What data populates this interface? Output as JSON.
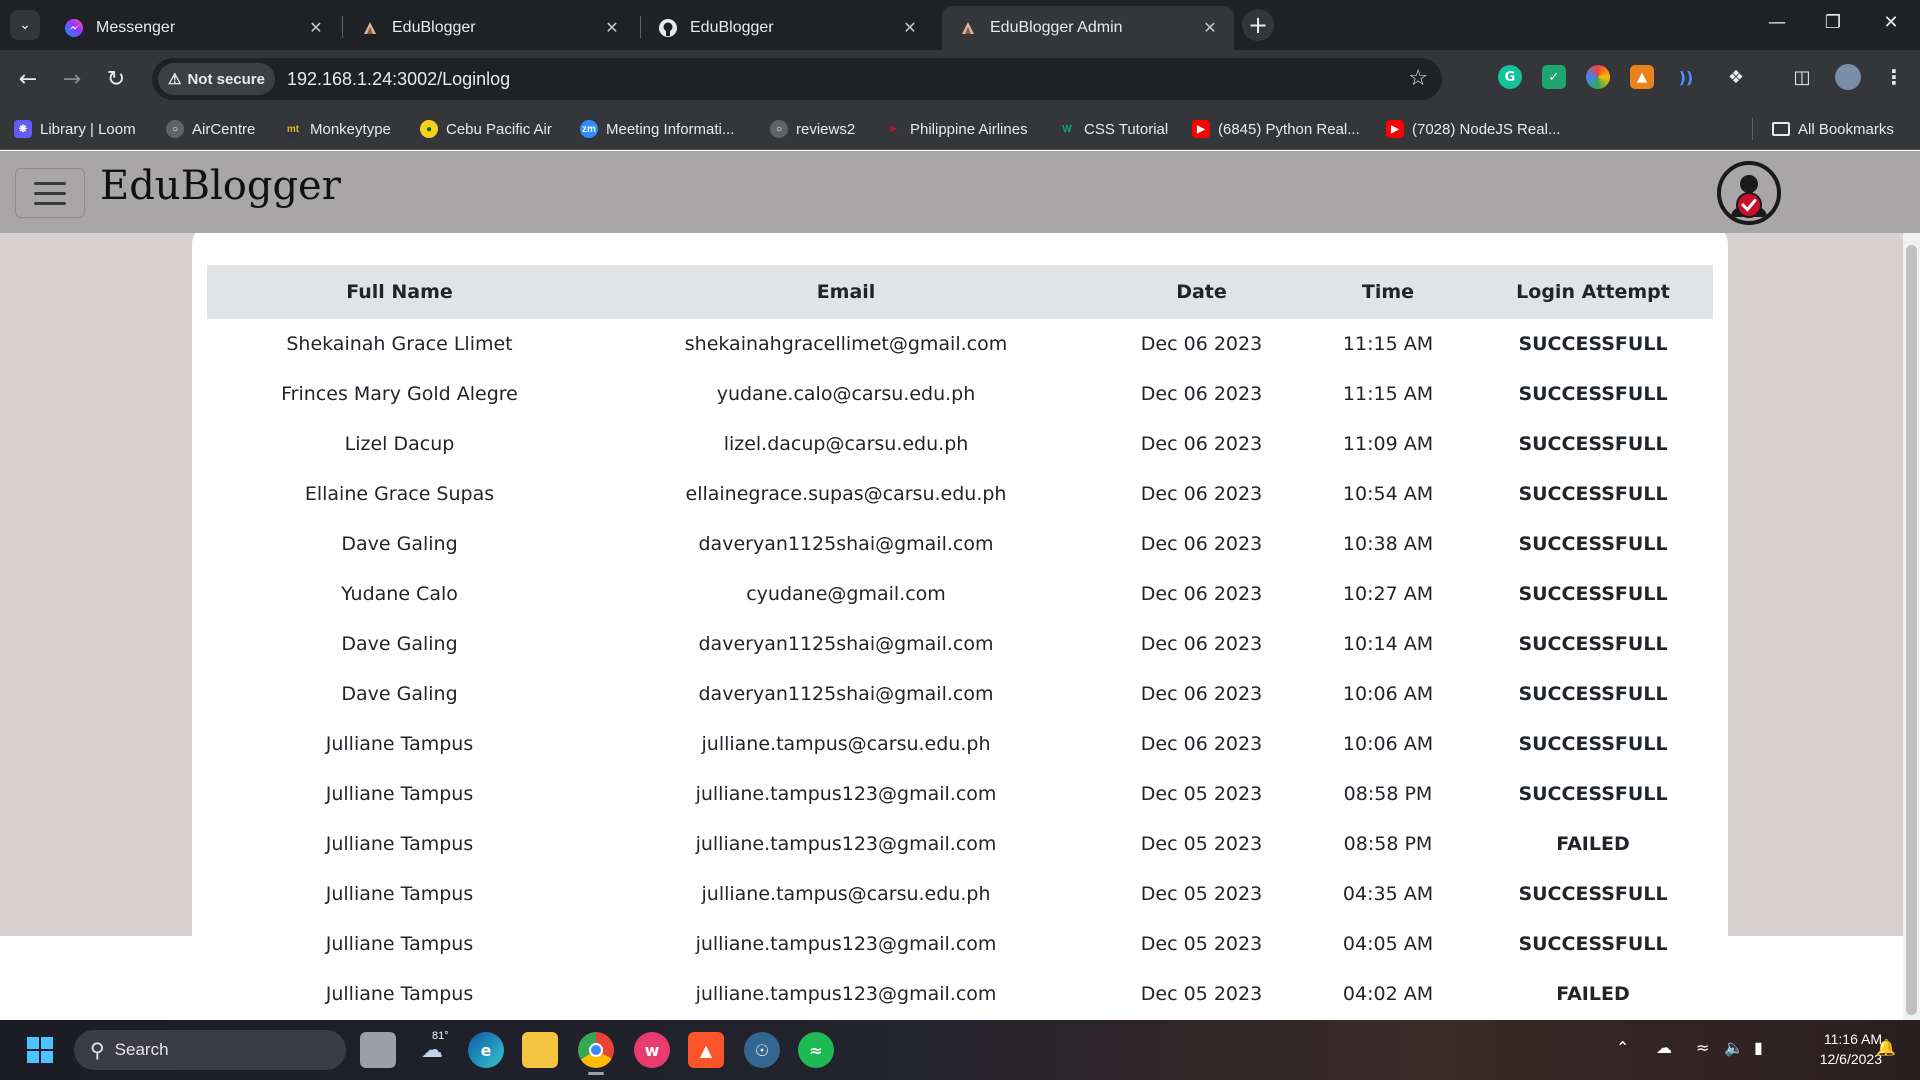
{
  "browser": {
    "tabs": [
      {
        "title": "Messenger",
        "icon": "messenger-icon",
        "active": false
      },
      {
        "title": "EduBlogger",
        "icon": "edublogger-icon",
        "active": false
      },
      {
        "title": "EduBlogger",
        "icon": "github-icon",
        "active": false
      },
      {
        "title": "EduBlogger Admin",
        "icon": "edublogger-icon",
        "active": true
      }
    ],
    "security_label": "Not secure",
    "url": "192.168.1.24:3002/Loginlog",
    "bookmarks": [
      {
        "label": "Library | Loom",
        "color": "#625df5"
      },
      {
        "label": "AirCentre",
        "color": "#5f6368"
      },
      {
        "label": "Monkeytype",
        "color": "#323437"
      },
      {
        "label": "Cebu Pacific Air",
        "color": "#f5d21a"
      },
      {
        "label": "Meeting Informati...",
        "color": "#2d8cff"
      },
      {
        "label": "reviews2",
        "color": "#5f6368"
      },
      {
        "label": "Philippine Airlines",
        "color": "#c8102e"
      },
      {
        "label": "CSS Tutorial",
        "color": "#04aa6d"
      },
      {
        "label": "(6845) Python Real...",
        "color": "#ff0000"
      },
      {
        "label": "(7028) NodeJS Real...",
        "color": "#ff0000"
      }
    ],
    "all_bookmarks": "All Bookmarks"
  },
  "app": {
    "brand": "EduBlogger"
  },
  "table": {
    "headers": [
      "Full Name",
      "Email",
      "Date",
      "Time",
      "Login Attempt"
    ],
    "rows": [
      [
        "Shekainah Grace Llimet",
        "shekainahgracellimet@gmail.com",
        "Dec 06 2023",
        "11:15 AM",
        "SUCCESSFULL"
      ],
      [
        "Frinces Mary Gold Alegre",
        "yudane.calo@carsu.edu.ph",
        "Dec 06 2023",
        "11:15 AM",
        "SUCCESSFULL"
      ],
      [
        "Lizel Dacup",
        "lizel.dacup@carsu.edu.ph",
        "Dec 06 2023",
        "11:09 AM",
        "SUCCESSFULL"
      ],
      [
        "Ellaine Grace Supas",
        "ellainegrace.supas@carsu.edu.ph",
        "Dec 06 2023",
        "10:54 AM",
        "SUCCESSFULL"
      ],
      [
        "Dave Galing",
        "daveryan1125shai@gmail.com",
        "Dec 06 2023",
        "10:38 AM",
        "SUCCESSFULL"
      ],
      [
        "Yudane Calo",
        "cyudane@gmail.com",
        "Dec 06 2023",
        "10:27 AM",
        "SUCCESSFULL"
      ],
      [
        "Dave Galing",
        "daveryan1125shai@gmail.com",
        "Dec 06 2023",
        "10:14 AM",
        "SUCCESSFULL"
      ],
      [
        "Dave Galing",
        "daveryan1125shai@gmail.com",
        "Dec 06 2023",
        "10:06 AM",
        "SUCCESSFULL"
      ],
      [
        "Julliane Tampus",
        "julliane.tampus@carsu.edu.ph",
        "Dec 06 2023",
        "10:06 AM",
        "SUCCESSFULL"
      ],
      [
        "Julliane Tampus",
        "julliane.tampus123@gmail.com",
        "Dec 05 2023",
        "08:58 PM",
        "SUCCESSFULL"
      ],
      [
        "Julliane Tampus",
        "julliane.tampus123@gmail.com",
        "Dec 05 2023",
        "08:58 PM",
        "FAILED"
      ],
      [
        "Julliane Tampus",
        "julliane.tampus@carsu.edu.ph",
        "Dec 05 2023",
        "04:35 AM",
        "SUCCESSFULL"
      ],
      [
        "Julliane Tampus",
        "julliane.tampus123@gmail.com",
        "Dec 05 2023",
        "04:05 AM",
        "SUCCESSFULL"
      ],
      [
        "Julliane Tampus",
        "julliane.tampus123@gmail.com",
        "Dec 05 2023",
        "04:02 AM",
        "FAILED"
      ]
    ]
  },
  "status_colors": {
    "SUCCESSFULL": "#066b06",
    "FAILED": "#8b0000"
  },
  "taskbar": {
    "search_label": "Search",
    "weather_temp": "81°",
    "time": "11:16 AM",
    "date": "12/6/2023"
  }
}
